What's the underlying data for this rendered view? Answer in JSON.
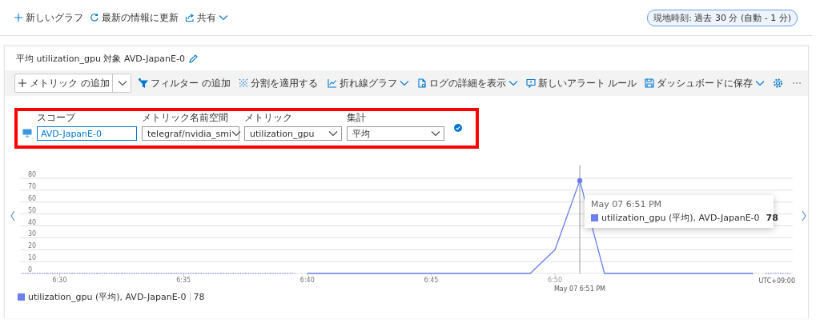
{
  "top_bar": {
    "items": [
      {
        "kind": "add",
        "label": "新しいグラフ",
        "dropdown": false
      },
      {
        "kind": "refresh",
        "label": "最新の情報に更新",
        "dropdown": false
      },
      {
        "kind": "share",
        "label": "共有",
        "dropdown": true
      }
    ],
    "time_range": "現地時刻: 過去 30 分 (自動 - 1 分)"
  },
  "chart_card": {
    "title": "平均 utilization_gpu 対象 AVD-JapanE-0",
    "commands_left": [
      {
        "kind": "add-metric",
        "label": "メトリック の追加",
        "dropdown": true
      },
      {
        "kind": "filter",
        "label": "フィルター の追加",
        "dropdown": false
      },
      {
        "kind": "split",
        "label": "分割を適用する",
        "dropdown": false
      }
    ],
    "commands_right": [
      {
        "kind": "chart-type",
        "label": "折れ線グラフ",
        "dropdown": true
      },
      {
        "kind": "logs",
        "label": "ログの詳細を表示",
        "dropdown": true
      },
      {
        "kind": "alert",
        "label": "新しいアラート ルール",
        "dropdown": false
      },
      {
        "kind": "save",
        "label": "ダッシュボードに保存",
        "dropdown": true
      },
      {
        "kind": "settings",
        "dropdown": false
      },
      {
        "kind": "more",
        "dropdown": false
      }
    ],
    "metric_selector": {
      "fields": [
        {
          "kind": "input",
          "label": "スコープ",
          "value": "AVD-JapanE-0"
        },
        {
          "kind": "dropdown",
          "label": "メトリック名前空間",
          "value": "telegraf/nvidia_smi"
        },
        {
          "kind": "dropdown",
          "label": "メトリック",
          "value": "utilization_gpu"
        },
        {
          "kind": "dropdown",
          "label": "集計",
          "value": "平均"
        }
      ]
    },
    "chart": {
      "chart_data": {
        "type": "line",
        "categories": [
          null,
          "6:30",
          null,
          null,
          null,
          null,
          "6:35",
          null,
          null,
          null,
          null,
          "6:40",
          null,
          null,
          null,
          null,
          "6:45",
          null,
          null,
          null,
          null,
          "6:50",
          null,
          null,
          null,
          null,
          null,
          null,
          null,
          null,
          null
        ],
        "series": [
          {
            "name": "utilization_gpu (平均), AVD-JapanE-0",
            "color": "#6b7ff0",
            "values": [
              null,
              null,
              null,
              null,
              null,
              null,
              null,
              null,
              null,
              null,
              null,
              0,
              0,
              0,
              0,
              0,
              0,
              0,
              0,
              0,
              0,
              20,
              78,
              0,
              0,
              0,
              0,
              0,
              0,
              0,
              null
            ]
          }
        ],
        "ylim": [
          0,
          80
        ],
        "grid": true,
        "yticks": [
          0,
          10,
          20,
          30,
          40,
          50,
          60,
          70,
          80
        ]
      },
      "crosshair": {
        "axis_label": "May 07 6:51 PM"
      },
      "timezone": "UTC+09:00",
      "tooltip": {
        "time": "May 07 6:51 PM",
        "series": "utilization_gpu (平均), AVD-JapanE-0",
        "value": "78"
      },
      "legend": [
        {
          "value": "78"
        }
      ]
    }
  }
}
